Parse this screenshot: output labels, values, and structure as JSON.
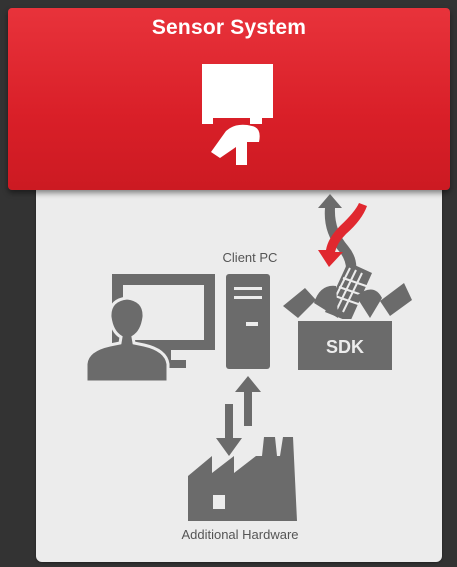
{
  "sensor_system": {
    "title": "Sensor System"
  },
  "client_pc": {
    "label": "Client PC"
  },
  "sdk": {
    "label": "SDK"
  },
  "additional_hardware": {
    "label": "Additional Hardware"
  },
  "colors": {
    "sensor_red": "#d91f28",
    "arrow_red": "#e0282f",
    "icon_gray": "#6b6b6b",
    "panel_light": "#ececec",
    "background_dark": "#333333"
  },
  "icons": [
    "sensor-device-icon",
    "user-icon",
    "monitor-icon",
    "pc-tower-icon",
    "sdk-box-icon",
    "keyboard-icon",
    "data-flow-arrows-icon",
    "hardware-factory-icon"
  ]
}
